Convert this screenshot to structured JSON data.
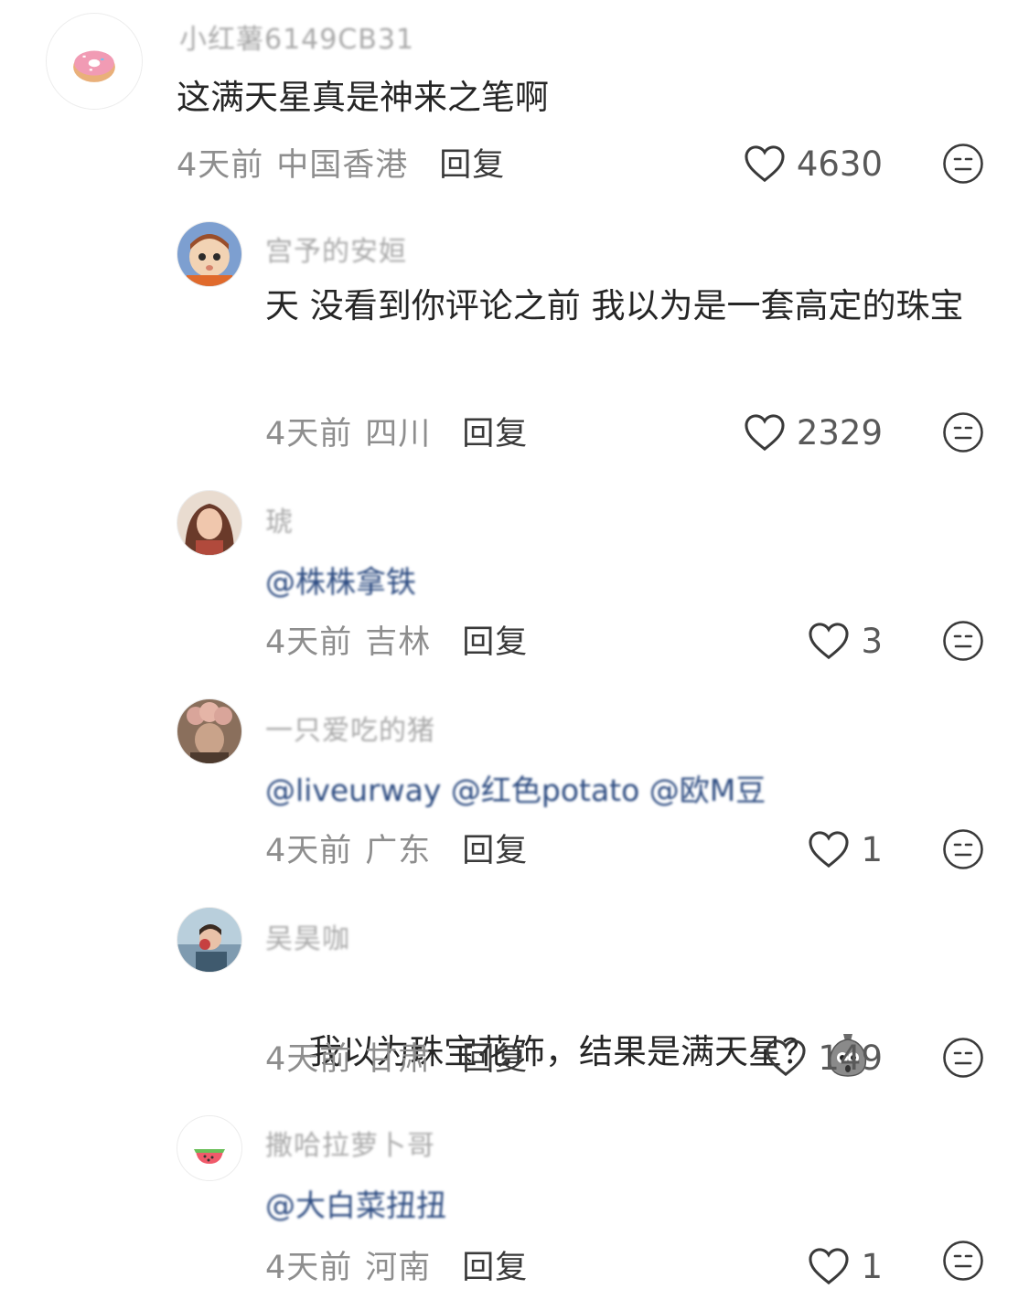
{
  "comments": [
    {
      "username": "小红薯6149CB31",
      "text": "这满天星真是神来之笔啊",
      "mention": "",
      "time": "4天前",
      "location": "中国香港",
      "reply_label": "回复",
      "likes": "4630",
      "avatar": "donut-avatar"
    },
    {
      "username": "宫予的安姮",
      "text": "天 没看到你评论之前 我以为是一套高定的珠宝",
      "mention": "",
      "time": "4天前",
      "location": "四川",
      "reply_label": "回复",
      "likes": "2329",
      "avatar": "cartoon-doll-avatar"
    },
    {
      "username": "琥",
      "text": "",
      "mention": "@株株拿铁",
      "time": "4天前",
      "location": "吉林",
      "reply_label": "回复",
      "likes": "3",
      "avatar": "woman-portrait-avatar"
    },
    {
      "username": "一只爱吃的猪",
      "text": "",
      "mention": "@liveurway @红色potato @欧M豆",
      "time": "4天前",
      "location": "广东",
      "reply_label": "回复",
      "likes": "1",
      "avatar": "flower-hat-avatar"
    },
    {
      "username": "吴昊咖",
      "text": "我以为珠宝花饰，结果是满天星？",
      "mention": "",
      "time": "4天前",
      "location": "甘肃",
      "reply_label": "回复",
      "likes": "149",
      "avatar": "seaside-photo-avatar",
      "emoji": "shocked-bag-emoji"
    },
    {
      "username": "撒哈拉萝卜哥",
      "text": "",
      "mention": "@大白菜扭扭",
      "time": "4天前",
      "location": "河南",
      "reply_label": "回复",
      "likes": "1",
      "avatar": "watermelon-avatar"
    }
  ],
  "colors": {
    "meta": "#8e8e8e",
    "mention": "#2b4a80",
    "text": "#262626"
  },
  "icons": [
    "heart-icon",
    "dislike-face-icon"
  ]
}
